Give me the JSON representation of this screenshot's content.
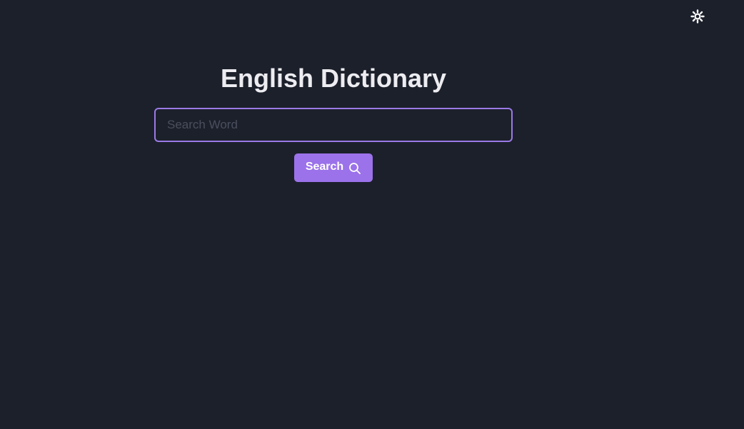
{
  "header": {
    "theme_toggle_icon": "sun-icon"
  },
  "main": {
    "title": "English Dictionary",
    "search": {
      "placeholder": "Search Word",
      "value": ""
    },
    "search_button": {
      "label": "Search",
      "icon": "search-icon"
    }
  },
  "colors": {
    "background": "#1c202b",
    "accent": "#9b72ea",
    "title_text": "#ececf1"
  }
}
